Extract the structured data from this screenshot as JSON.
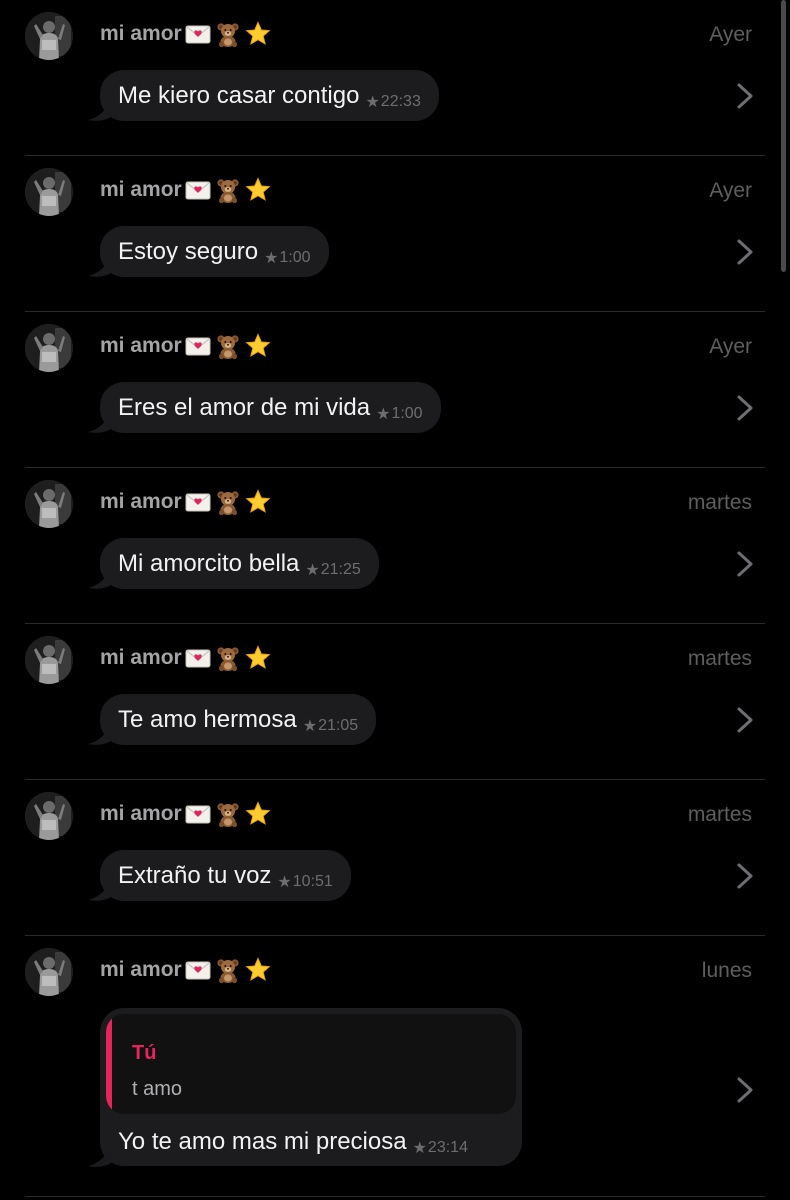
{
  "conversations": [
    {
      "sender": "mi amor",
      "time_label": "Ayer",
      "message": "Me kiero casar contigo",
      "message_time": "22:33"
    },
    {
      "sender": "mi amor",
      "time_label": "Ayer",
      "message": "Estoy seguro",
      "message_time": "1:00"
    },
    {
      "sender": "mi amor",
      "time_label": "Ayer",
      "message": "Eres el amor de mi vida",
      "message_time": "1:00"
    },
    {
      "sender": "mi amor",
      "time_label": "martes",
      "message": "Mi amorcito bella",
      "message_time": "21:25"
    },
    {
      "sender": "mi amor",
      "time_label": "martes",
      "message": "Te amo hermosa",
      "message_time": "21:05"
    },
    {
      "sender": "mi amor",
      "time_label": "martes",
      "message": "Extraño tu voz",
      "message_time": "10:51"
    },
    {
      "sender": "mi amor",
      "time_label": "lunes",
      "quote_author": "Tú",
      "quote_text": "t amo",
      "message": "Yo te amo mas mi preciosa",
      "message_time": "23:14"
    }
  ],
  "sender_emojis": [
    "love-letter-icon",
    "teddy-bear-icon",
    "star-icon"
  ],
  "star_glyph": "★",
  "colors": {
    "background": "#000000",
    "bubble": "#1c1c1e",
    "quote_accent": "#e5265a",
    "sender_text": "#a4a4a6",
    "time_text": "#5e5e60"
  }
}
